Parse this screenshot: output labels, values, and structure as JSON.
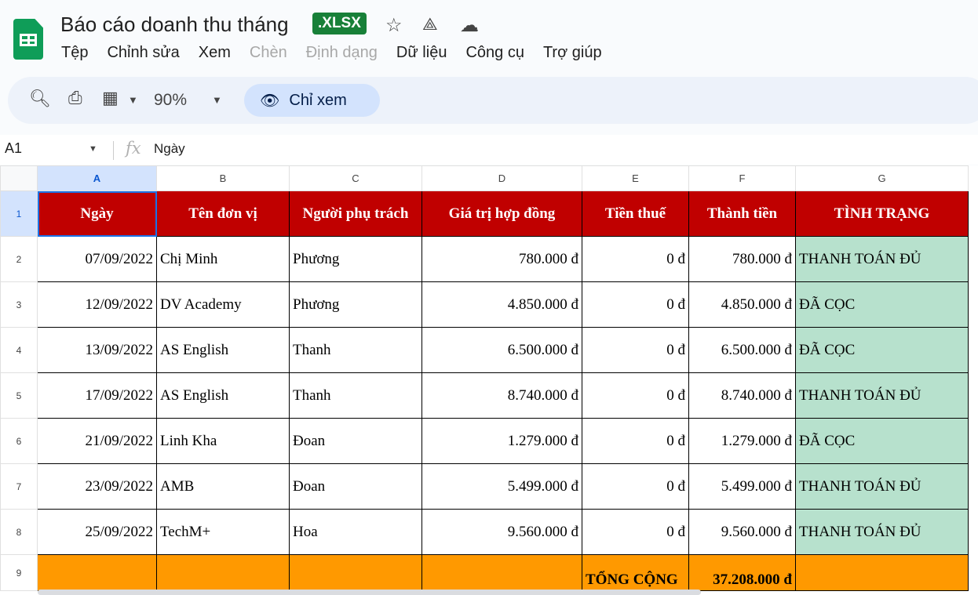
{
  "doc": {
    "title": "Báo cáo doanh thu tháng",
    "badge": ".XLSX"
  },
  "menu": [
    "Tệp",
    "Chỉnh sửa",
    "Xem",
    "Chèn",
    "Định dạng",
    "Dữ liệu",
    "Công cụ",
    "Trợ giúp"
  ],
  "menu_disabled": [
    "Chèn",
    "Định dạng"
  ],
  "toolbar": {
    "zoom": "90%",
    "view_only": "Chỉ xem"
  },
  "formula_bar": {
    "cell": "A1",
    "fx": "fx",
    "value": "Ngày"
  },
  "columns": [
    "A",
    "B",
    "C",
    "D",
    "E",
    "F",
    "G"
  ],
  "headers": [
    "Ngày",
    "Tên đơn vị",
    "Người phụ trách",
    "Giá trị hợp đồng",
    "Tiền thuế",
    "Thành tiền",
    "TÌNH TRẠNG"
  ],
  "rows": [
    [
      "07/09/2022",
      "Chị Minh",
      "Phương",
      "780.000 đ",
      "0 đ",
      "780.000 đ",
      "THANH TOÁN ĐỦ"
    ],
    [
      "12/09/2022",
      "DV Academy",
      "Phương",
      "4.850.000 đ",
      "0 đ",
      "4.850.000 đ",
      "ĐÃ CỌC"
    ],
    [
      "13/09/2022",
      "AS English",
      "Thanh",
      "6.500.000 đ",
      "0 đ",
      "6.500.000 đ",
      "ĐÃ CỌC"
    ],
    [
      "17/09/2022",
      "AS English",
      "Thanh",
      "8.740.000 đ",
      "0 đ",
      "8.740.000 đ",
      "THANH TOÁN ĐỦ"
    ],
    [
      "21/09/2022",
      "Linh Kha",
      "Đoan",
      "1.279.000 đ",
      "0 đ",
      "1.279.000 đ",
      "ĐÃ CỌC"
    ],
    [
      "23/09/2022",
      "AMB",
      "Đoan",
      "5.499.000 đ",
      "0 đ",
      "5.499.000 đ",
      "THANH TOÁN ĐỦ"
    ],
    [
      "25/09/2022",
      "TechM+",
      "Hoa",
      "9.560.000 đ",
      "0 đ",
      "9.560.000 đ",
      "THANH TOÁN ĐỦ"
    ]
  ],
  "total": {
    "label": "TỔNG CỘNG",
    "value": "37.208.000 đ"
  },
  "colors": {
    "header_bg": "#c00000",
    "status_bg": "#b7e1cd",
    "total_bg": "#ff9900"
  }
}
